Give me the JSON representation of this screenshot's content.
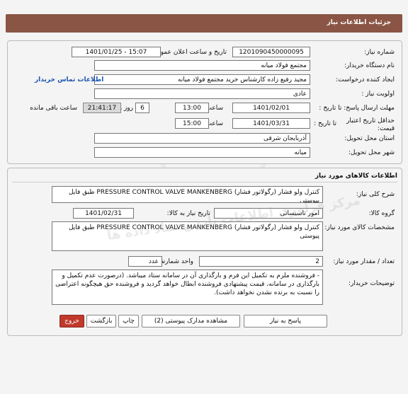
{
  "header": {
    "title": "جزئیات اطلاعات نیاز"
  },
  "need_info": {
    "need_number_label": "شماره نیاز:",
    "need_number": "1201090450000095",
    "announce_label": "تاریخ و ساعت اعلان عمومی:",
    "announce_value": "1401/01/25 - 15:07",
    "buyer_org_label": "نام دستگاه خریدار:",
    "buyer_org": "مجتمع فولاد میانه",
    "requester_label": "ایجاد کننده درخواست:",
    "requester": "مجید رفیع زاده کارشناس خرید مجتمع فولاد میانه",
    "buyer_contact_link": "اطلاعات تماس خریدار",
    "priority_label": "اولویت نیاز :",
    "priority": "عادی",
    "reply_deadline_label": "مهلت ارسال پاسخ: تا تاریخ :",
    "reply_date": "1401/02/01",
    "time_label": "ساعت",
    "reply_time": "13:00",
    "days_value": "6",
    "days_label": "روز و",
    "remaining_time": "21:41:17",
    "remaining_label": "ساعت باقی مانده",
    "price_validity_label": "حداقل تاریخ اعتبار قیمت:",
    "to_date_label": "تا تاریخ :",
    "validity_date": "1401/03/31",
    "validity_time": "15:00",
    "province_label": "استان محل تحویل:",
    "province": "آذربایجان شرقی",
    "city_label": "شهر محل تحویل:",
    "city": "میانه"
  },
  "goods": {
    "section_title": "اطلاعات کالاهای مورد نیاز",
    "summary_label": "شرح کلی نیاز:",
    "summary": "کنترل ولو فشار (رگولاتور فشار)  PRESSURE CONTROL VALVE MANKENBERG  طبق فایل پیوستی",
    "group_label": "گروه کالا:",
    "group_value": "امور تاسیساتی",
    "need_date_label": "تاریخ نیاز به کالا:",
    "need_date": "1401/02/31",
    "spec_label": "مشخصات کالای مورد نیاز:",
    "spec": "کنترل ولو فشار (رگولاتور فشار)  PRESSURE CONTROL VALVE MANKENBERG  طبق فایل پیوستی",
    "qty_label": "تعداد / مقدار مورد نیاز:",
    "qty": "2",
    "unit_label": "واحد شمارش:",
    "unit": "عدد",
    "buyer_notes_label": "توضیحات خریدار:",
    "buyer_notes": "- فروشنده ملزم به تکمیل این فرم و بارگذاری آن در سامانه ستاد میباشد. (درصورت عدم تکمیل و بارگذاری در سامانه، قیمت پیشنهادی فروشنده ابطال خواهد گردید و فروشنده حق هیچگونه اعتراضی را نسبت به برنده نشدن نخواهد داشت)."
  },
  "watermark": "مرکز فرآوری اطلاعات پارس نماد داده ها",
  "buttons": {
    "reply": "پاسخ به نیاز",
    "attachments": "مشاهده مدارک پیوستی (2)",
    "print": "چاپ",
    "back": "بازگشت",
    "exit": "خروج"
  }
}
